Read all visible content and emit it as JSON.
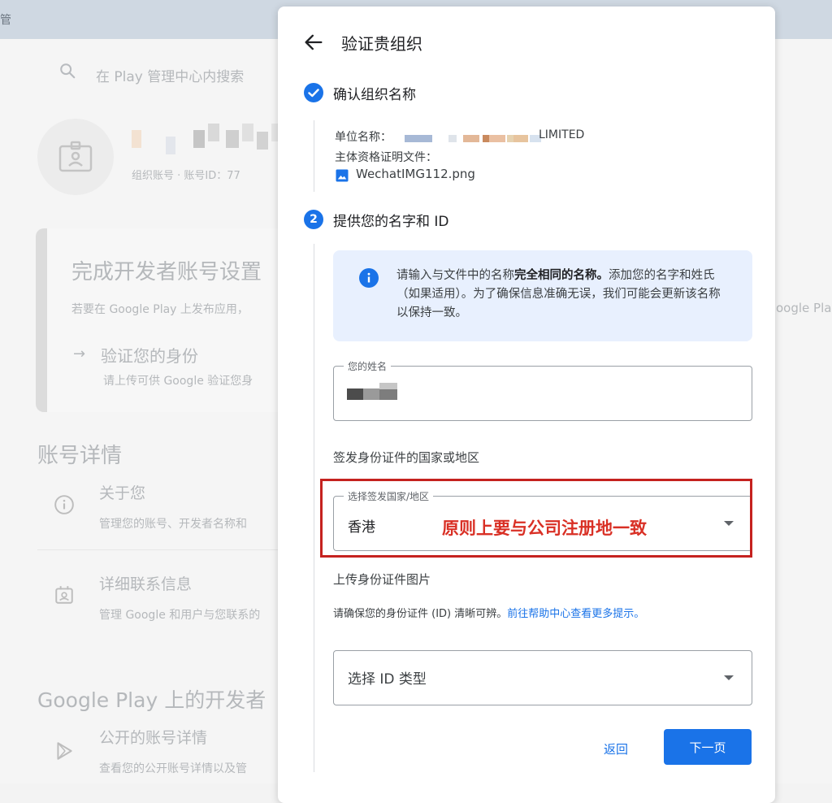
{
  "background": {
    "topbar_cut_text": "管",
    "search_placeholder": "在 Play 管理中心内搜索",
    "account_meta": "组织账号 · 账号ID：77",
    "setup_card": {
      "title": "完成开发者账号设置",
      "desc": "若要在 Google Play 上发布应用，",
      "verify_title": "验证您的身份",
      "verify_sub": "请上传可供 Google 验证您身"
    },
    "section_title": "账号详情",
    "items": [
      {
        "title": "关于您",
        "desc": "管理您的账号、开发者名称和"
      },
      {
        "title": "详细联系信息",
        "desc": "管理 Google 和用户与您联系的"
      }
    ],
    "gp_section_title": "Google Play 上的开发者",
    "gp_items": [
      {
        "title": "公开的账号详情",
        "desc": "查看您的公开账号详情以及管"
      }
    ],
    "right_cut_text": "oogle Pla"
  },
  "dialog": {
    "title": "验证贵组织",
    "step1": {
      "title": "确认组织名称",
      "org_name_label": "单位名称：",
      "org_name_suffix": "LIMITED",
      "doc_label": "主体资格证明文件：",
      "file_name": "WechatIMG112.png"
    },
    "step2": {
      "number": "2",
      "title": "提供您的名字和 ID",
      "info_pre": "请输入与文件中的名称",
      "info_bold": "完全相同的名称。",
      "info_post": "添加您的名字和姓氏（如果适用）。为了确保信息准确无误，我们可能会更新该名称以保持一致。",
      "name_field_label": "您的姓名",
      "country_section_label": "签发身份证件的国家或地区",
      "country_field_label": "选择签发国家/地区",
      "country_value": "香港",
      "annotation": "原则上要与公司注册地一致",
      "upload_label": "上传身份证件图片",
      "upload_hint": "请确保您的身份证件 (ID) 清晰可辨。",
      "help_link": "前往帮助中心查看更多提示。",
      "id_type_placeholder": "选择 ID 类型"
    },
    "buttons": {
      "back": "返回",
      "next": "下一页"
    }
  },
  "colors": {
    "accent": "#1a73e8",
    "info_bg": "#e8f0fe",
    "annotation_red": "#d93025"
  }
}
